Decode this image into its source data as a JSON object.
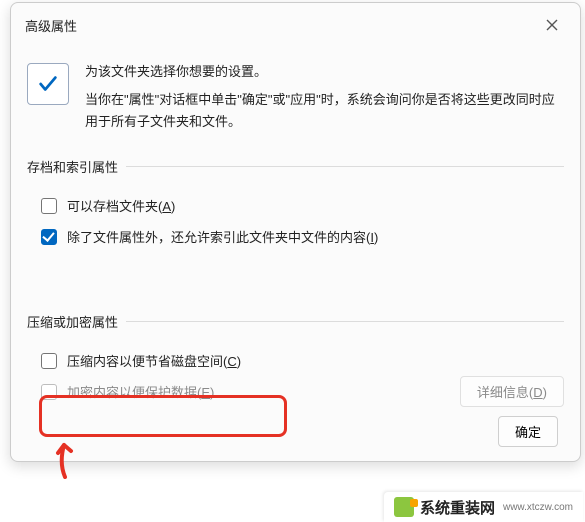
{
  "dialog": {
    "title": "高级属性",
    "intro_line1": "为该文件夹选择你想要的设置。",
    "intro_line2": "当你在\"属性\"对话框中单击\"确定\"或\"应用\"时，系统会询问你是否将这些更改同时应用于所有子文件夹和文件。"
  },
  "group_archive": {
    "title": "存档和索引属性",
    "archive_label": "可以存档文件夹(",
    "archive_accel": "A",
    "archive_label_end": ")",
    "index_label": "除了文件属性外，还允许索引此文件夹中文件的内容(",
    "index_accel": "I",
    "index_label_end": ")"
  },
  "group_compress": {
    "title": "压缩或加密属性",
    "compress_label": "压缩内容以便节省磁盘空间(",
    "compress_accel": "C",
    "compress_label_end": ")",
    "encrypt_label": "加密内容以便保护数据(",
    "encrypt_accel": "E",
    "encrypt_label_end": ")",
    "details_btn": "详细信息(",
    "details_accel": "D",
    "details_end": ")"
  },
  "footer": {
    "ok": "确定"
  },
  "watermark": {
    "text": "系统重装网",
    "url": "www.xtczw.com"
  }
}
